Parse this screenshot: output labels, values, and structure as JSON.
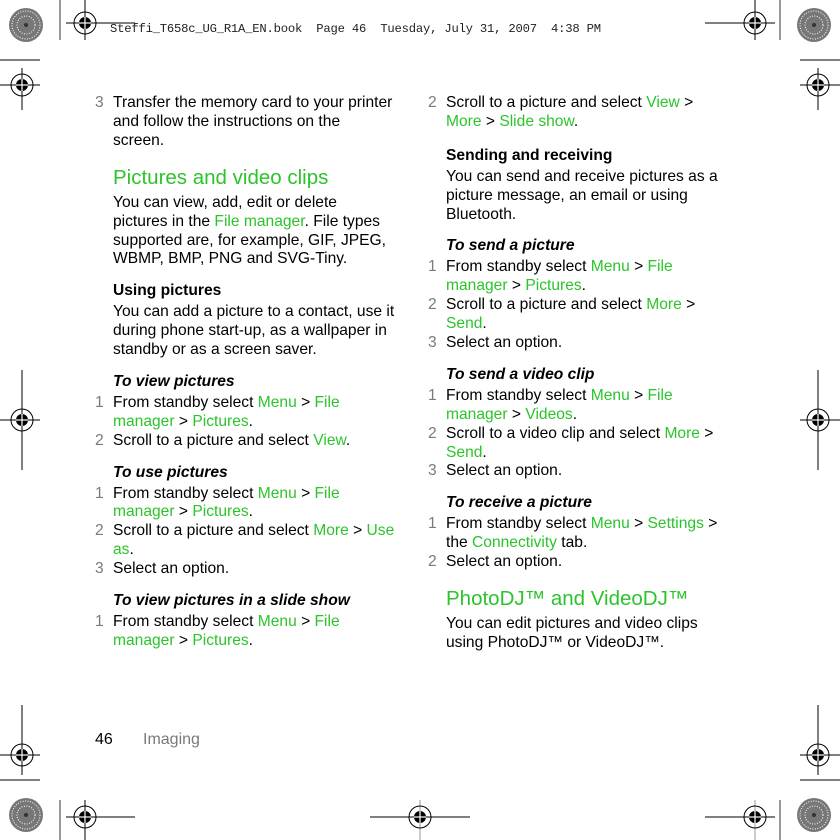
{
  "slug_line": "Steffi_T658c_UG_R1A_EN.book  Page 46  Tuesday, July 31, 2007  4:38 PM",
  "accent_color": "#2bc42b",
  "footer": {
    "page_number": "46",
    "section": "Imaging"
  },
  "left_column": {
    "step_transfer": {
      "num": "3",
      "text": "Transfer the memory card to your printer and follow the instructions on the screen."
    },
    "heading_pictures": "Pictures and video clips",
    "intro": {
      "pre": "You can view, add, edit or delete pictures in the ",
      "link": "File manager",
      "post": ". File types supported are, for example, GIF, JPEG, WBMP, BMP, PNG and SVG-Tiny."
    },
    "using_pictures": {
      "title": "Using pictures",
      "text": "You can add a picture to a contact, use it during phone start-up, as a wallpaper in standby or as a screen saver."
    },
    "to_view_pictures": {
      "title": "To view pictures",
      "steps": [
        {
          "num": "1",
          "pre": "From standby select ",
          "l1": "Menu",
          "s1": " > ",
          "l2": "File manager",
          "s2": " > ",
          "l3": "Pictures",
          "post": "."
        },
        {
          "num": "2",
          "pre": "Scroll to a picture and select ",
          "l1": "View",
          "post": "."
        }
      ]
    },
    "to_use_pictures": {
      "title": "To use pictures",
      "steps": [
        {
          "num": "1",
          "pre": "From standby select ",
          "l1": "Menu",
          "s1": " > ",
          "l2": "File manager",
          "s2": " > ",
          "l3": "Pictures",
          "post": "."
        },
        {
          "num": "2",
          "pre": "Scroll to a picture and select ",
          "l1": "More",
          "s1": " > ",
          "l2": "Use as",
          "post": "."
        },
        {
          "num": "3",
          "text": "Select an option."
        }
      ]
    },
    "to_view_slide_show": {
      "title": "To view pictures in a slide show",
      "steps": [
        {
          "num": "1",
          "pre": "From standby select ",
          "l1": "Menu",
          "s1": " > ",
          "l2": "File manager",
          "s2": " > ",
          "l3": "Pictures",
          "post": "."
        }
      ]
    }
  },
  "right_column": {
    "slide_show_step2": {
      "num": "2",
      "pre": "Scroll to a picture and select ",
      "l1": "View",
      "s1": " > ",
      "l2": "More",
      "s2": " > ",
      "l3": "Slide show",
      "post": "."
    },
    "sending_receiving": {
      "title": "Sending and receiving",
      "text": "You can send and receive pictures as a picture message, an email or using Bluetooth."
    },
    "to_send_picture": {
      "title": "To send a picture",
      "steps": [
        {
          "num": "1",
          "pre": "From standby select ",
          "l1": "Menu",
          "s1": " > ",
          "l2": "File manager",
          "s2": " > ",
          "l3": "Pictures",
          "post": "."
        },
        {
          "num": "2",
          "pre": "Scroll to a picture and select ",
          "l1": "More",
          "s1": " > ",
          "l2": "Send",
          "post": "."
        },
        {
          "num": "3",
          "text": "Select an option."
        }
      ]
    },
    "to_send_video": {
      "title": "To send a video clip",
      "steps": [
        {
          "num": "1",
          "pre": "From standby select ",
          "l1": "Menu",
          "s1": " > ",
          "l2": "File manager",
          "s2": " > ",
          "l3": "Videos",
          "post": "."
        },
        {
          "num": "2",
          "pre": "Scroll to a video clip and select ",
          "l1": "More",
          "s1": " > ",
          "l2": "Send",
          "post": "."
        },
        {
          "num": "3",
          "text": "Select an option."
        }
      ]
    },
    "to_receive_picture": {
      "title": "To receive a picture",
      "steps": [
        {
          "num": "1",
          "pre": "From standby select ",
          "l1": "Menu",
          "s1": " > ",
          "l2": "Settings",
          "s2": " > the ",
          "l3": "Connectivity",
          "post": " tab."
        },
        {
          "num": "2",
          "text": "Select an option."
        }
      ]
    },
    "heading_photodj": "PhotoDJ™ and VideoDJ™",
    "photodj_text": "You can edit pictures and video clips using PhotoDJ™ or VideoDJ™."
  }
}
